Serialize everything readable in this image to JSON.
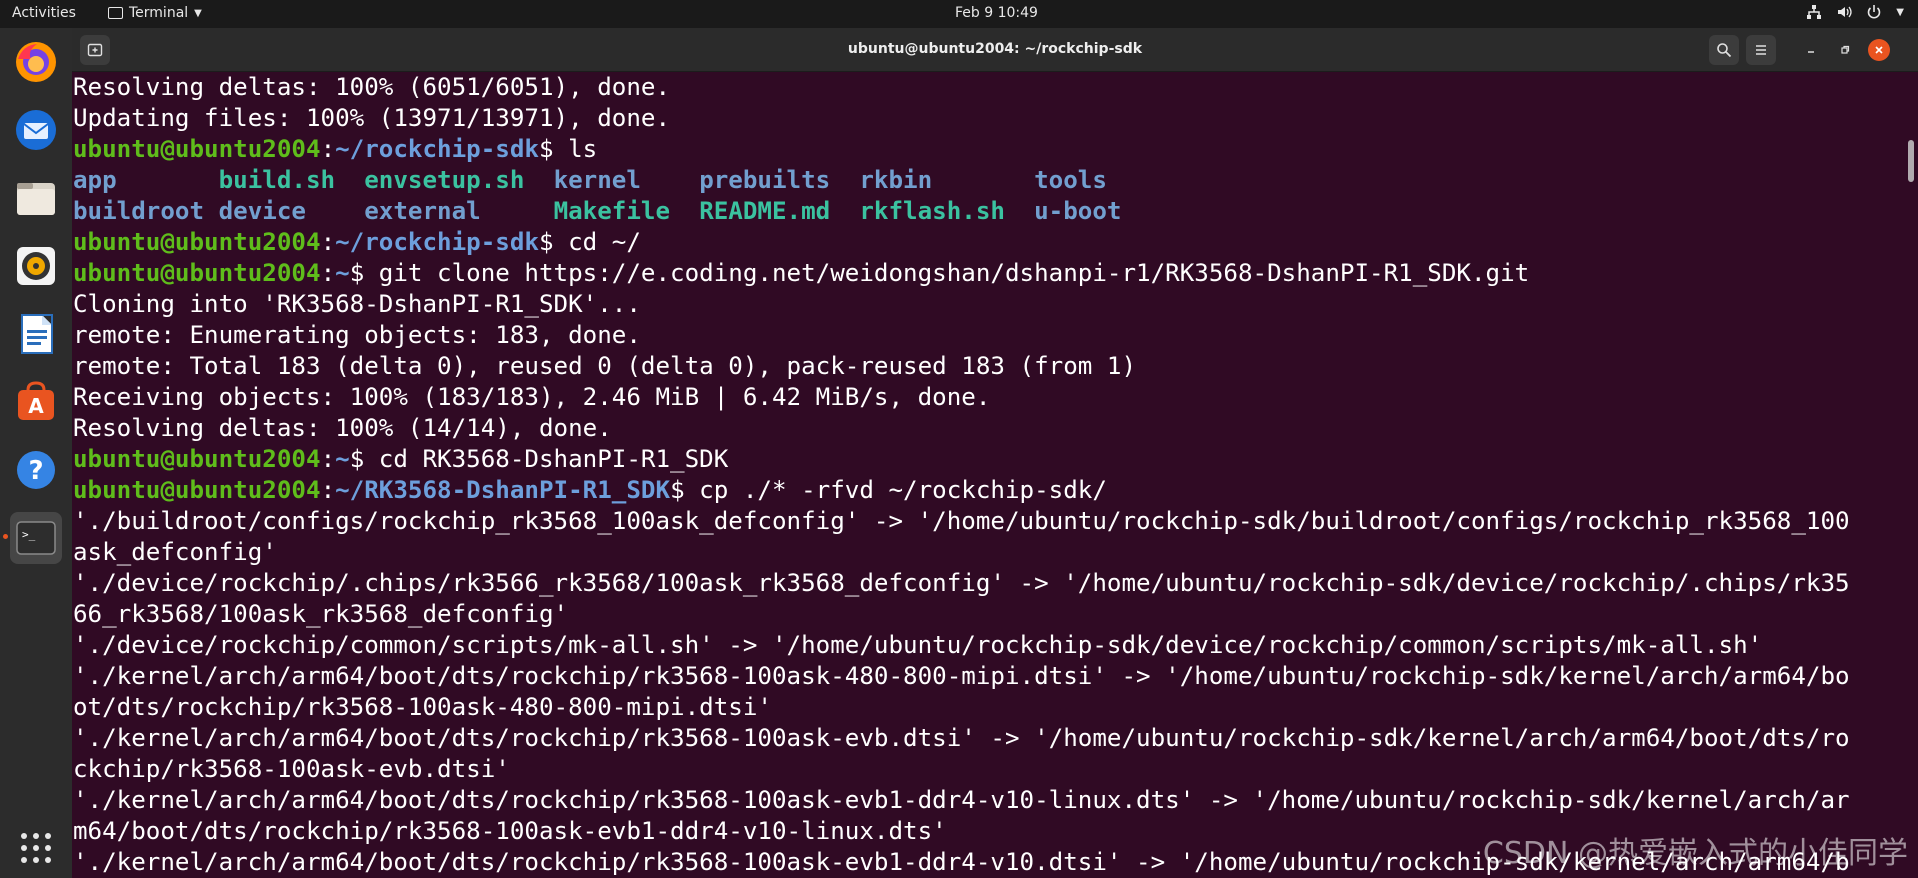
{
  "topbar": {
    "activities": "Activities",
    "app_name": "Terminal",
    "clock": "Feb 9  10:49"
  },
  "window": {
    "title": "ubuntu@ubuntu2004: ~/rockchip-sdk"
  },
  "terminal": {
    "lines": [
      [
        {
          "t": "Resolving deltas: 100% (6051/6051), done.",
          "c": "c"
        }
      ],
      [
        {
          "t": "Updating files: 100% (13971/13971), done.",
          "c": "c"
        }
      ],
      [
        {
          "t": "ubuntu@ubuntu2004",
          "c": "u"
        },
        {
          "t": ":",
          "c": "c"
        },
        {
          "t": "~/rockchip-sdk",
          "c": "p"
        },
        {
          "t": "$ ls",
          "c": "c"
        }
      ],
      [
        {
          "t": "app       ",
          "c": "d"
        },
        {
          "t": "build.sh",
          "c": "x"
        },
        {
          "t": "  ",
          "c": "c"
        },
        {
          "t": "envsetup.sh",
          "c": "x"
        },
        {
          "t": "  ",
          "c": "c"
        },
        {
          "t": "kernel",
          "c": "d"
        },
        {
          "t": "    ",
          "c": "c"
        },
        {
          "t": "prebuilts",
          "c": "d"
        },
        {
          "t": "  ",
          "c": "c"
        },
        {
          "t": "rkbin",
          "c": "d"
        },
        {
          "t": "       ",
          "c": "c"
        },
        {
          "t": "tools",
          "c": "d"
        }
      ],
      [
        {
          "t": "buildroot",
          "c": "d"
        },
        {
          "t": " ",
          "c": "c"
        },
        {
          "t": "device",
          "c": "d"
        },
        {
          "t": "    ",
          "c": "c"
        },
        {
          "t": "external",
          "c": "d"
        },
        {
          "t": "     ",
          "c": "c"
        },
        {
          "t": "Makefile",
          "c": "x"
        },
        {
          "t": "  ",
          "c": "c"
        },
        {
          "t": "README.md",
          "c": "x"
        },
        {
          "t": "  ",
          "c": "c"
        },
        {
          "t": "rkflash.sh",
          "c": "x"
        },
        {
          "t": "  ",
          "c": "c"
        },
        {
          "t": "u-boot",
          "c": "d"
        }
      ],
      [
        {
          "t": "ubuntu@ubuntu2004",
          "c": "u"
        },
        {
          "t": ":",
          "c": "c"
        },
        {
          "t": "~/rockchip-sdk",
          "c": "p"
        },
        {
          "t": "$ cd ~/",
          "c": "c"
        }
      ],
      [
        {
          "t": "ubuntu@ubuntu2004",
          "c": "u"
        },
        {
          "t": ":",
          "c": "c"
        },
        {
          "t": "~",
          "c": "p"
        },
        {
          "t": "$ git clone https://e.coding.net/weidongshan/dshanpi-r1/RK3568-DshanPI-R1_SDK.git",
          "c": "c"
        }
      ],
      [
        {
          "t": "Cloning into 'RK3568-DshanPI-R1_SDK'...",
          "c": "c"
        }
      ],
      [
        {
          "t": "remote: Enumerating objects: 183, done.",
          "c": "c"
        }
      ],
      [
        {
          "t": "remote: Total 183 (delta 0), reused 0 (delta 0), pack-reused 183 (from 1)",
          "c": "c"
        }
      ],
      [
        {
          "t": "Receiving objects: 100% (183/183), 2.46 MiB | 6.42 MiB/s, done.",
          "c": "c"
        }
      ],
      [
        {
          "t": "Resolving deltas: 100% (14/14), done.",
          "c": "c"
        }
      ],
      [
        {
          "t": "ubuntu@ubuntu2004",
          "c": "u"
        },
        {
          "t": ":",
          "c": "c"
        },
        {
          "t": "~",
          "c": "p"
        },
        {
          "t": "$ cd RK3568-DshanPI-R1_SDK",
          "c": "c"
        }
      ],
      [
        {
          "t": "ubuntu@ubuntu2004",
          "c": "u"
        },
        {
          "t": ":",
          "c": "c"
        },
        {
          "t": "~/RK3568-DshanPI-R1_SDK",
          "c": "p"
        },
        {
          "t": "$ cp ./* -rfvd ~/rockchip-sdk/",
          "c": "c"
        }
      ],
      [
        {
          "t": "'./buildroot/configs/rockchip_rk3568_100ask_defconfig' -> '/home/ubuntu/rockchip-sdk/buildroot/configs/rockchip_rk3568_100",
          "c": "c"
        }
      ],
      [
        {
          "t": "ask_defconfig'",
          "c": "c"
        }
      ],
      [
        {
          "t": "'./device/rockchip/.chips/rk3566_rk3568/100ask_rk3568_defconfig' -> '/home/ubuntu/rockchip-sdk/device/rockchip/.chips/rk35",
          "c": "c"
        }
      ],
      [
        {
          "t": "66_rk3568/100ask_rk3568_defconfig'",
          "c": "c"
        }
      ],
      [
        {
          "t": "'./device/rockchip/common/scripts/mk-all.sh' -> '/home/ubuntu/rockchip-sdk/device/rockchip/common/scripts/mk-all.sh'",
          "c": "c"
        }
      ],
      [
        {
          "t": "'./kernel/arch/arm64/boot/dts/rockchip/rk3568-100ask-480-800-mipi.dtsi' -> '/home/ubuntu/rockchip-sdk/kernel/arch/arm64/bo",
          "c": "c"
        }
      ],
      [
        {
          "t": "ot/dts/rockchip/rk3568-100ask-480-800-mipi.dtsi'",
          "c": "c"
        }
      ],
      [
        {
          "t": "'./kernel/arch/arm64/boot/dts/rockchip/rk3568-100ask-evb.dtsi' -> '/home/ubuntu/rockchip-sdk/kernel/arch/arm64/boot/dts/ro",
          "c": "c"
        }
      ],
      [
        {
          "t": "ckchip/rk3568-100ask-evb.dtsi'",
          "c": "c"
        }
      ],
      [
        {
          "t": "'./kernel/arch/arm64/boot/dts/rockchip/rk3568-100ask-evb1-ddr4-v10-linux.dts' -> '/home/ubuntu/rockchip-sdk/kernel/arch/ar",
          "c": "c"
        }
      ],
      [
        {
          "t": "m64/boot/dts/rockchip/rk3568-100ask-evb1-ddr4-v10-linux.dts'",
          "c": "c"
        }
      ],
      [
        {
          "t": "'./kernel/arch/arm64/boot/dts/rockchip/rk3568-100ask-evb1-ddr4-v10.dtsi' -> '/home/ubuntu/rockchip-sdk/kernel/arch/arm64/b",
          "c": "c"
        }
      ]
    ]
  },
  "watermark": "CSDN @热爱嵌入式的小佳同学",
  "colors": {
    "terminal_bg": "#300a24",
    "prompt_user": "#5fbd1b",
    "prompt_path": "#6d9fdc",
    "dir": "#729fcf",
    "exec": "#3bc2a0",
    "accent": "#e95420"
  },
  "icons": {
    "dock": [
      "firefox-icon",
      "thunderbird-icon",
      "files-icon",
      "rhythmbox-icon",
      "libreoffice-writer-icon",
      "software-center-icon",
      "help-icon",
      "terminal-icon",
      "show-apps-icon"
    ],
    "tray": [
      "network-icon",
      "volume-icon",
      "power-icon",
      "dropdown-icon"
    ]
  }
}
